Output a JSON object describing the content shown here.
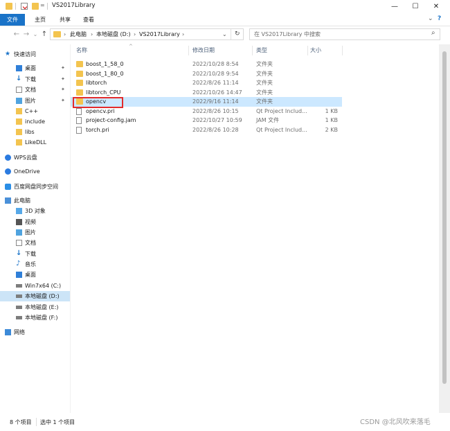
{
  "window": {
    "title": "VS2017Library",
    "quick_access_glyph": "=",
    "minimize": "—",
    "maximize": "☐",
    "close": "✕",
    "help": "?"
  },
  "ribbon": {
    "tabs": [
      "文件",
      "主页",
      "共享",
      "查看"
    ],
    "expand": "⌄"
  },
  "nav": {
    "back": "←",
    "forward": "→",
    "recent": "⌄",
    "up": "↑"
  },
  "address": {
    "crumbs": [
      "此电脑",
      "本地磁盘 (D:)",
      "VS2017Library"
    ],
    "sep": "›",
    "dropdown": "⌄",
    "refresh": "↻"
  },
  "search": {
    "placeholder": "在 VS2017Library 中搜索",
    "icon": "⌕"
  },
  "sidebar": {
    "items": [
      {
        "label": "快速访问",
        "icon": "star-icon",
        "pinned": false
      },
      {
        "label": "桌面",
        "icon": "desktop-icon",
        "pinned": true
      },
      {
        "label": "下载",
        "icon": "download-icon",
        "pinned": true
      },
      {
        "label": "文档",
        "icon": "document-icon",
        "pinned": true
      },
      {
        "label": "图片",
        "icon": "picture-icon",
        "pinned": true
      },
      {
        "label": "C++",
        "icon": "folder-icon",
        "pinned": false
      },
      {
        "label": "include",
        "icon": "folder-icon",
        "pinned": false
      },
      {
        "label": "libs",
        "icon": "folder-icon",
        "pinned": false
      },
      {
        "label": "LikeDLL",
        "icon": "folder-icon",
        "pinned": false
      },
      {
        "label": "WPS云盘",
        "icon": "cloud-icon",
        "pinned": false
      },
      {
        "label": "OneDrive",
        "icon": "cloud-icon",
        "pinned": false
      },
      {
        "label": "百度网盘同步空间",
        "icon": "baidu-icon",
        "pinned": false
      },
      {
        "label": "此电脑",
        "icon": "computer-icon",
        "pinned": false
      },
      {
        "label": "3D 对象",
        "icon": "cube-icon",
        "pinned": false
      },
      {
        "label": "视频",
        "icon": "video-icon",
        "pinned": false
      },
      {
        "label": "图片",
        "icon": "picture-icon",
        "pinned": false
      },
      {
        "label": "文档",
        "icon": "document-icon",
        "pinned": false
      },
      {
        "label": "下载",
        "icon": "download-icon",
        "pinned": false
      },
      {
        "label": "音乐",
        "icon": "music-icon",
        "pinned": false
      },
      {
        "label": "桌面",
        "icon": "desktop-icon",
        "pinned": false
      },
      {
        "label": "Win7x64 (C:)",
        "icon": "drive-icon",
        "pinned": false
      },
      {
        "label": "本地磁盘 (D:)",
        "icon": "drive-icon",
        "pinned": false,
        "selected": true
      },
      {
        "label": "本地磁盘 (E:)",
        "icon": "drive-icon",
        "pinned": false
      },
      {
        "label": "本地磁盘 (F:)",
        "icon": "drive-icon",
        "pinned": false
      },
      {
        "label": "网络",
        "icon": "network-icon",
        "pinned": false
      }
    ],
    "pin_glyph": "✦"
  },
  "columns": {
    "name": "名称",
    "date": "修改日期",
    "type": "类型",
    "size": "大小",
    "sort": "^"
  },
  "files": [
    {
      "name": "boost_1_58_0",
      "date": "2022/10/28 8:54",
      "type": "文件夹",
      "size": "",
      "kind": "folder"
    },
    {
      "name": "boost_1_80_0",
      "date": "2022/10/28 9:54",
      "type": "文件夹",
      "size": "",
      "kind": "folder"
    },
    {
      "name": "libtorch",
      "date": "2022/8/26 11:14",
      "type": "文件夹",
      "size": "",
      "kind": "folder"
    },
    {
      "name": "libtorch_CPU",
      "date": "2022/10/26 14:47",
      "type": "文件夹",
      "size": "",
      "kind": "folder"
    },
    {
      "name": "opencv",
      "date": "2022/9/16 11:14",
      "type": "文件夹",
      "size": "",
      "kind": "folder",
      "selected": true
    },
    {
      "name": "opencv.pri",
      "date": "2022/8/26 10:15",
      "type": "Qt Project Includ...",
      "size": "1 KB",
      "kind": "file"
    },
    {
      "name": "project-config.jam",
      "date": "2022/10/27 10:59",
      "type": "JAM 文件",
      "size": "1 KB",
      "kind": "file"
    },
    {
      "name": "torch.pri",
      "date": "2022/8/26 10:28",
      "type": "Qt Project Includ...",
      "size": "2 KB",
      "kind": "file"
    }
  ],
  "status": {
    "count": "8 个项目",
    "selected": "选中 1 个项目"
  },
  "watermark": "CSDN @北风吹来落毛",
  "colors": {
    "accent": "#1a73c8",
    "selection": "#cce8ff",
    "highlight_box": "#e32b2b",
    "folder": "#f3c44f"
  }
}
